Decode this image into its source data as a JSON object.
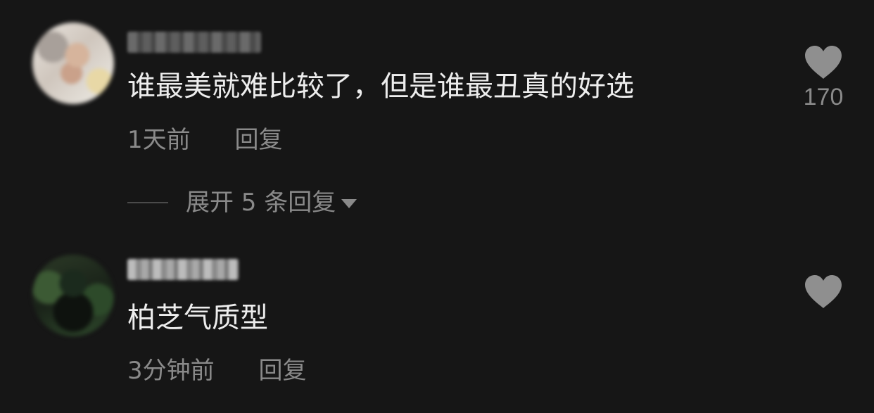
{
  "comments": [
    {
      "text": "谁最美就难比较了，但是谁最丑真的好选",
      "time": "1天前",
      "reply_label": "回复",
      "like_count": "170",
      "expand_replies_label": "展开 5 条回复"
    },
    {
      "text": "柏芝气质型",
      "time": "3分钟前",
      "reply_label": "回复",
      "like_count": ""
    }
  ],
  "icons": {
    "like": "heart-icon",
    "expand": "caret-down-icon"
  },
  "colors": {
    "background": "#161616",
    "primary_text": "#ededed",
    "secondary_text": "#8a8a8a",
    "heart": "#8f8f8f"
  }
}
